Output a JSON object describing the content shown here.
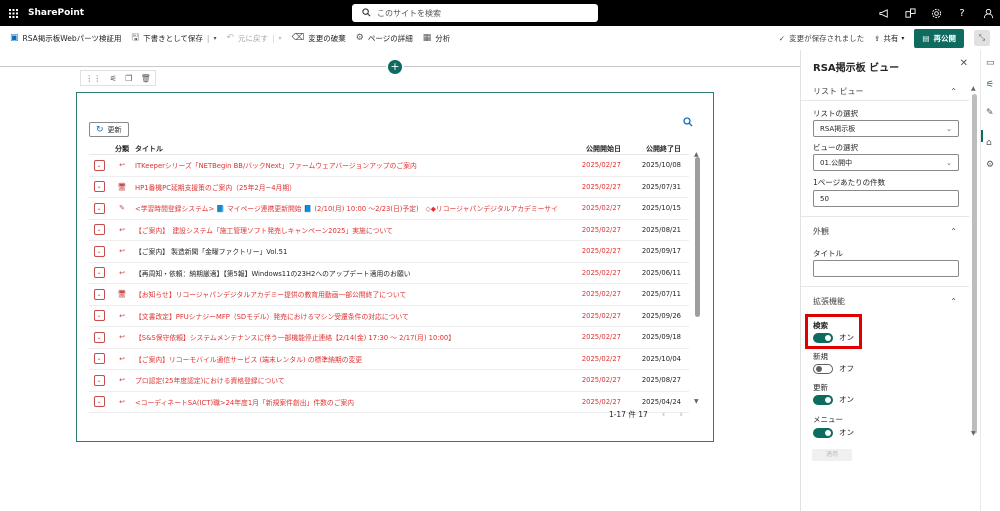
{
  "topbar": {
    "brand": "SharePoint",
    "search_placeholder": "このサイトを検索"
  },
  "commandbar": {
    "items": [
      {
        "label": "RSA掲示板Webパーツ検証用",
        "icon": "page-icon",
        "disabled": false
      },
      {
        "label": "下書きとして保存",
        "icon": "save-icon",
        "disabled": false
      },
      {
        "label": "元に戻す",
        "icon": "undo-icon",
        "disabled": true
      },
      {
        "label": "変更の破棄",
        "icon": "discard-icon",
        "disabled": false
      },
      {
        "label": "ページの詳細",
        "icon": "gear-icon",
        "disabled": false
      },
      {
        "label": "分析",
        "icon": "analytics-icon",
        "disabled": false
      }
    ],
    "saved_status": "変更が保存されました",
    "share_label": "共有",
    "republish_label": "再公開"
  },
  "webpart": {
    "refresh_label": "更新",
    "columns": {
      "category": "分類",
      "title": "タイトル",
      "start": "公開開始日",
      "end": "公開終了日"
    },
    "rows": [
      {
        "icon": "↩",
        "title": "ITKeeperシリーズ「NETBegin BB/バックNext」ファームウェアバージョンアップのご案内",
        "start": "2025/02/27",
        "end": "2025/10/08",
        "red": true
      },
      {
        "icon": "🖥",
        "title": "HP1番機PC延期支援策のご案内（25年2月~4月期）",
        "start": "2025/02/27",
        "end": "2025/07/31",
        "red": true
      },
      {
        "icon": "✎",
        "title": "<学習時間登録システム> 📘 マイページ連携更新開始 📘 (2/10(月) 10:00 ～2/23(日)予定)　◇◆リコージャパンデジタルアカデミーサイト◆◇",
        "start": "2025/02/27",
        "end": "2025/10/15",
        "red": true
      },
      {
        "icon": "↩",
        "title": "【ご案内】　建設システム「施工管理ソフト発売しキャンペーン2025」実施について",
        "start": "2025/02/27",
        "end": "2025/08/21",
        "red": true
      },
      {
        "icon": "↩",
        "title": "【ご案内】 製造新聞「金曜ファクトリー」Vol.51",
        "start": "2025/02/27",
        "end": "2025/09/17",
        "red": false
      },
      {
        "icon": "↩",
        "title": "【再周知・依頼：納期厳適】【第5報】Windows11の23H2へのアップデート適用のお願い",
        "start": "2025/02/27",
        "end": "2025/06/11",
        "red": false
      },
      {
        "icon": "🖥",
        "title": "【お知らせ】リコージャパンデジタルアカデミー提供の教育用動画一部公開終了について",
        "start": "2025/02/27",
        "end": "2025/07/11",
        "red": true
      },
      {
        "icon": "↩",
        "title": "【文書改定】PFUシナジーMFP（SDモデル）発売におけるマシン受還条件の対応について",
        "start": "2025/02/27",
        "end": "2025/09/26",
        "red": true
      },
      {
        "icon": "↩",
        "title": "【S&S保守依頼】システムメンテナンスに伴う一部機能停止連絡【2/14(金) 17:30 ～ 2/17(月) 10:00】",
        "start": "2025/02/27",
        "end": "2025/09/18",
        "red": true
      },
      {
        "icon": "↩",
        "title": "【ご案内】リコーモバイル通信サービス (端末レンタル) の標準納期の変更",
        "start": "2025/02/27",
        "end": "2025/10/04",
        "red": true
      },
      {
        "icon": "↩",
        "title": "プロ認定(25年度認定)における資格登録について",
        "start": "2025/02/27",
        "end": "2025/08/27",
        "red": true
      },
      {
        "icon": "↩",
        "title": "<コーディネートSA(ICT)職>24年度1月「新規案件創出」件数のご案内",
        "start": "2025/02/27",
        "end": "2025/04/24",
        "red": true
      }
    ],
    "pager_label": "1-17 件 17"
  },
  "panel": {
    "title": "RSA掲示板 ビュー",
    "list_view_section": "リスト ビュー",
    "list_select_label": "リストの選択",
    "list_select_value": "RSA掲示板",
    "view_select_label": "ビューの選択",
    "view_select_value": "01.公開中",
    "per_page_label": "1ページあたりの件数",
    "per_page_value": "50",
    "appearance_section": "外観",
    "title_label": "タイトル",
    "title_value": "",
    "extensions_section": "拡張機能",
    "toggles": [
      {
        "label": "検索",
        "state": "オン",
        "on": true
      },
      {
        "label": "新規",
        "state": "オフ",
        "on": false
      },
      {
        "label": "更新",
        "state": "オン",
        "on": true
      },
      {
        "label": "メニュー",
        "state": "オン",
        "on": true
      }
    ],
    "apply_label": "適用"
  },
  "colors": {
    "accent": "#0d6b5f",
    "red_text": "#e03131",
    "highlight": "#e00000"
  }
}
